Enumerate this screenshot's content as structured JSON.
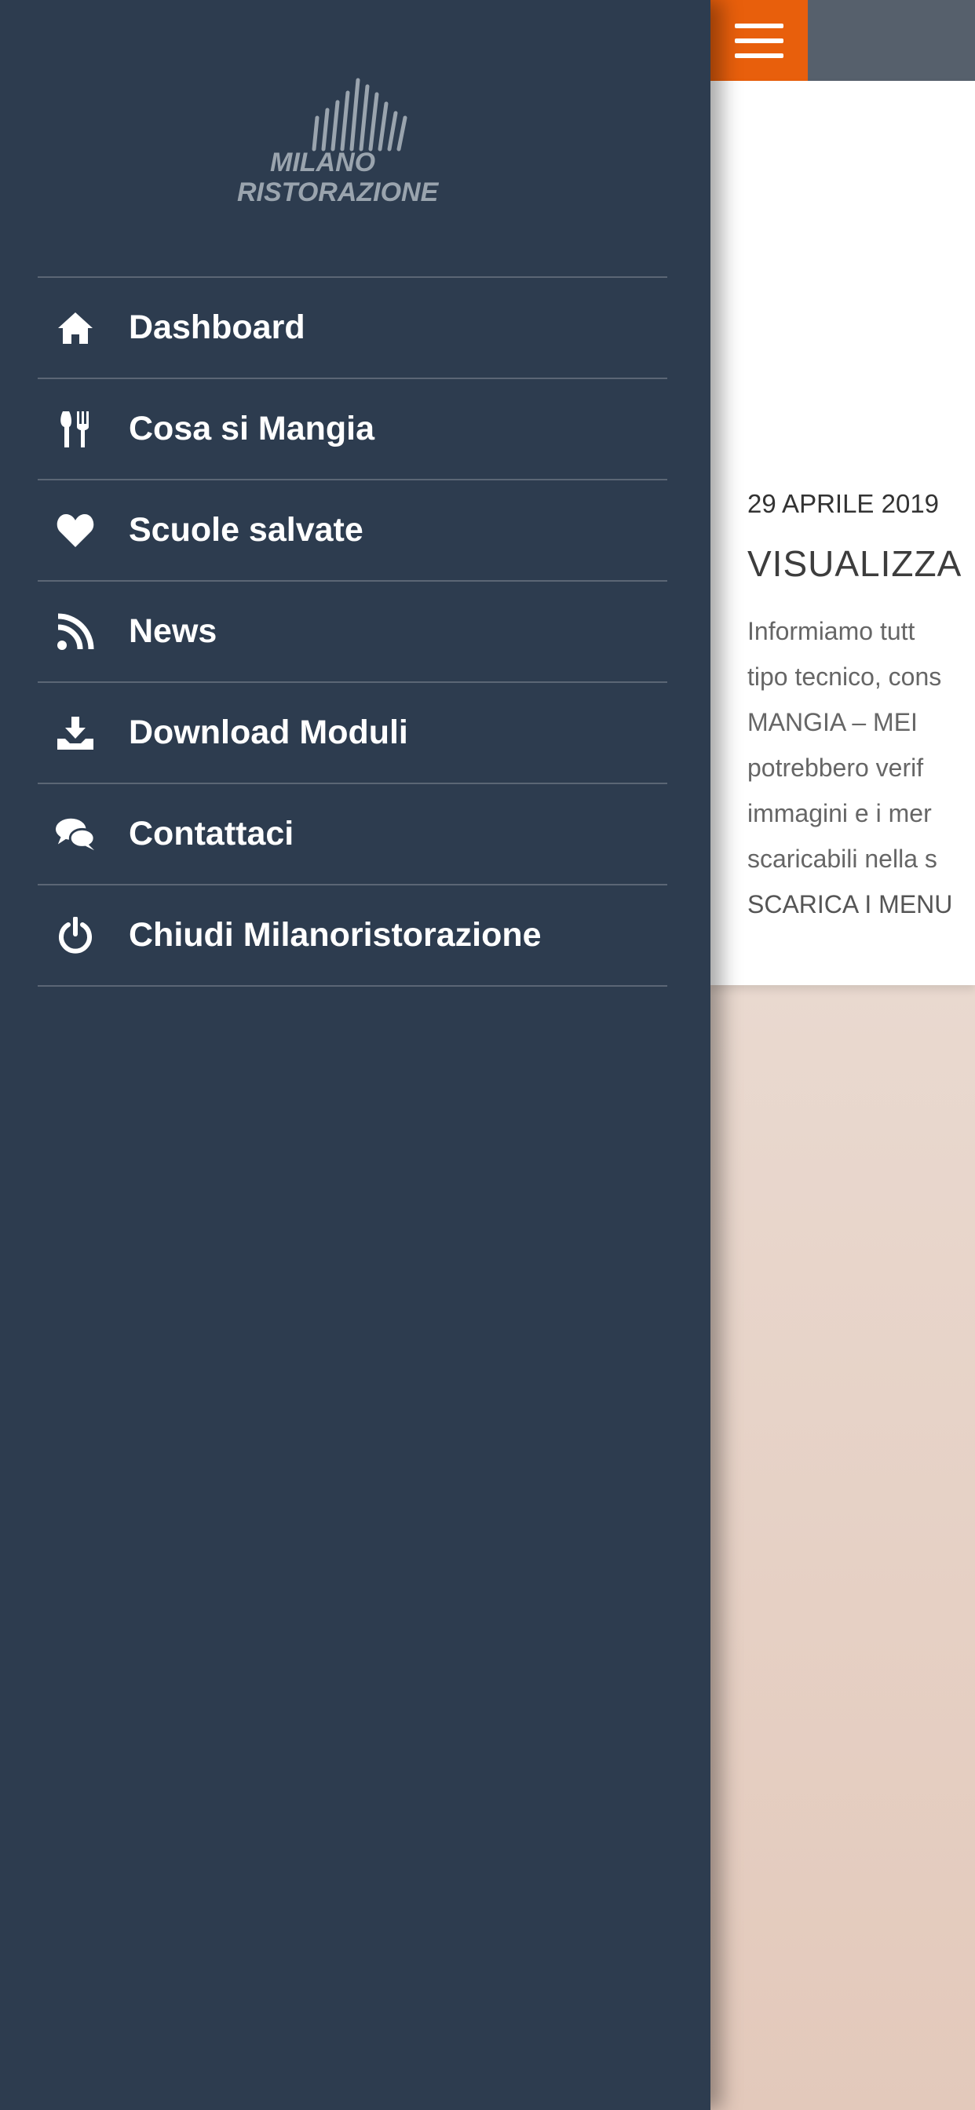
{
  "brand": {
    "logo_line1": "MILANO",
    "logo_line2": "RISTORAZIONE"
  },
  "drawer": {
    "items": [
      {
        "label": "Dashboard",
        "icon": "home-icon"
      },
      {
        "label": "Cosa si Mangia",
        "icon": "cutlery-icon"
      },
      {
        "label": "Scuole salvate",
        "icon": "heart-icon"
      },
      {
        "label": "News",
        "icon": "rss-icon"
      },
      {
        "label": "Download Moduli",
        "icon": "download-icon"
      },
      {
        "label": "Contattaci",
        "icon": "chat-icon"
      },
      {
        "label": "Chiudi Milanoristorazione",
        "icon": "power-icon"
      }
    ]
  },
  "main": {
    "menu_icon": "hamburger-icon",
    "news": {
      "date": "29 APRILE 2019",
      "title": "VISUALIZZA",
      "lines": [
        "Informiamo tutt",
        "tipo tecnico, cons",
        "MANGIA – MEI",
        "potrebbero verif",
        "immagini e i mer",
        "scaricabili nella s"
      ],
      "link": "SCARICA I MENU"
    }
  },
  "colors": {
    "drawer_bg": "#2d3c4f",
    "accent": "#e85f0c",
    "topbar": "#56606c",
    "divider": "#5b6675"
  }
}
